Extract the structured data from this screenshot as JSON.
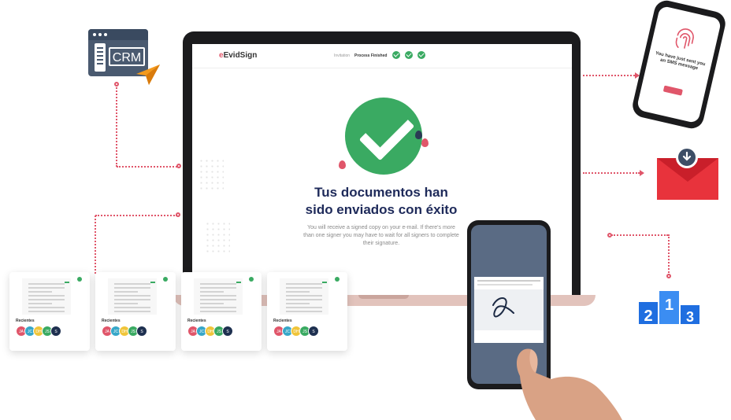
{
  "crm": {
    "label": "CRM"
  },
  "app": {
    "logo_prefix": "e",
    "logo_name": "EvidSign",
    "steps": {
      "prev_label": "Invitation",
      "current_label": "Process Finished",
      "completed": 3
    }
  },
  "success": {
    "title_line1": "Tus documentos han",
    "title_line2": "sido enviados con éxito",
    "message": "You will receive a signed copy on your e-mail. If there's more than one signer you may have to wait for all signers to complete their signature."
  },
  "sms": {
    "message": "You have just sent you an SMS message"
  },
  "cards": [
    {
      "label": "Recientes",
      "avatars": [
        {
          "initials": "JA",
          "color": "#e0566a"
        },
        {
          "initials": "JC",
          "color": "#37a7c8"
        },
        {
          "initials": "DH",
          "color": "#f0c53a"
        },
        {
          "initials": "JS",
          "color": "#3aaa62"
        },
        {
          "initials": "S",
          "color": "#1e3050"
        }
      ]
    },
    {
      "label": "Recientes",
      "avatars": [
        {
          "initials": "JA",
          "color": "#e0566a"
        },
        {
          "initials": "JC",
          "color": "#37a7c8"
        },
        {
          "initials": "DH",
          "color": "#f0c53a"
        },
        {
          "initials": "JS",
          "color": "#3aaa62"
        },
        {
          "initials": "S",
          "color": "#1e3050"
        }
      ]
    },
    {
      "label": "Recientes",
      "avatars": [
        {
          "initials": "JA",
          "color": "#e0566a"
        },
        {
          "initials": "JC",
          "color": "#37a7c8"
        },
        {
          "initials": "DH",
          "color": "#f0c53a"
        },
        {
          "initials": "JS",
          "color": "#3aaa62"
        },
        {
          "initials": "S",
          "color": "#1e3050"
        }
      ]
    },
    {
      "label": "Recientes",
      "avatars": [
        {
          "initials": "JA",
          "color": "#e0566a"
        },
        {
          "initials": "JC",
          "color": "#37a7c8"
        },
        {
          "initials": "DH",
          "color": "#f0c53a"
        },
        {
          "initials": "JS",
          "color": "#3aaa62"
        },
        {
          "initials": "S",
          "color": "#1e3050"
        }
      ]
    }
  ],
  "podium": {
    "first": "1",
    "second": "2",
    "third": "3"
  },
  "colors": {
    "accent": "#e0566a",
    "success": "#3aaa62",
    "navy": "#1e2a5a"
  }
}
